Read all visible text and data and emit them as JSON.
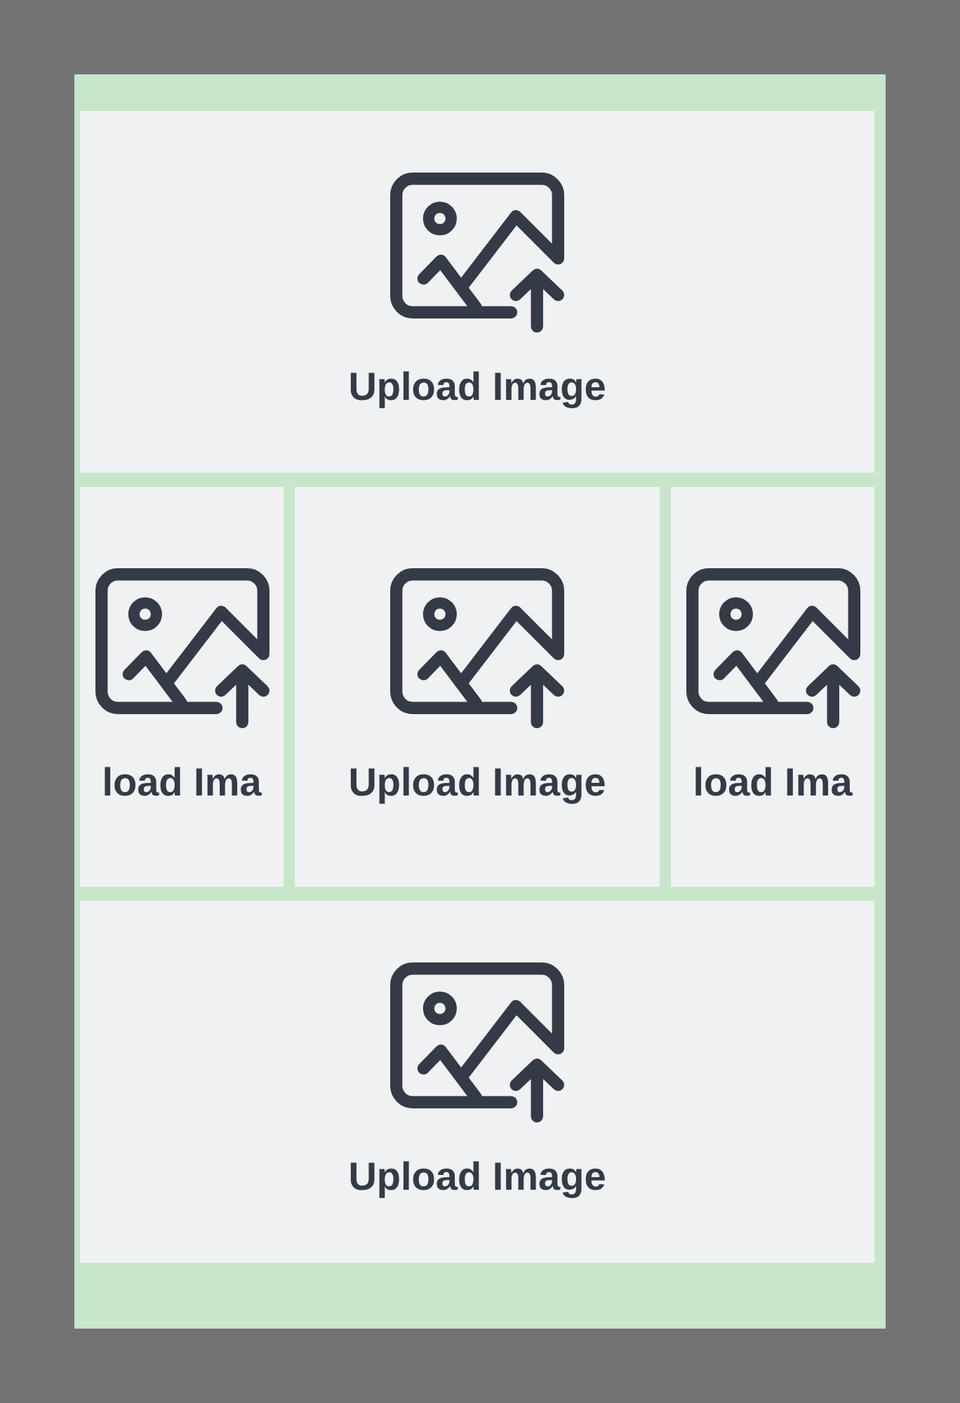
{
  "rows": [
    [
      {
        "label": "Upload Image"
      }
    ],
    [
      {
        "label": "load Ima"
      },
      {
        "label": "Upload Image"
      },
      {
        "label": "load Ima"
      }
    ],
    [
      {
        "label": "Upload Image"
      }
    ]
  ]
}
